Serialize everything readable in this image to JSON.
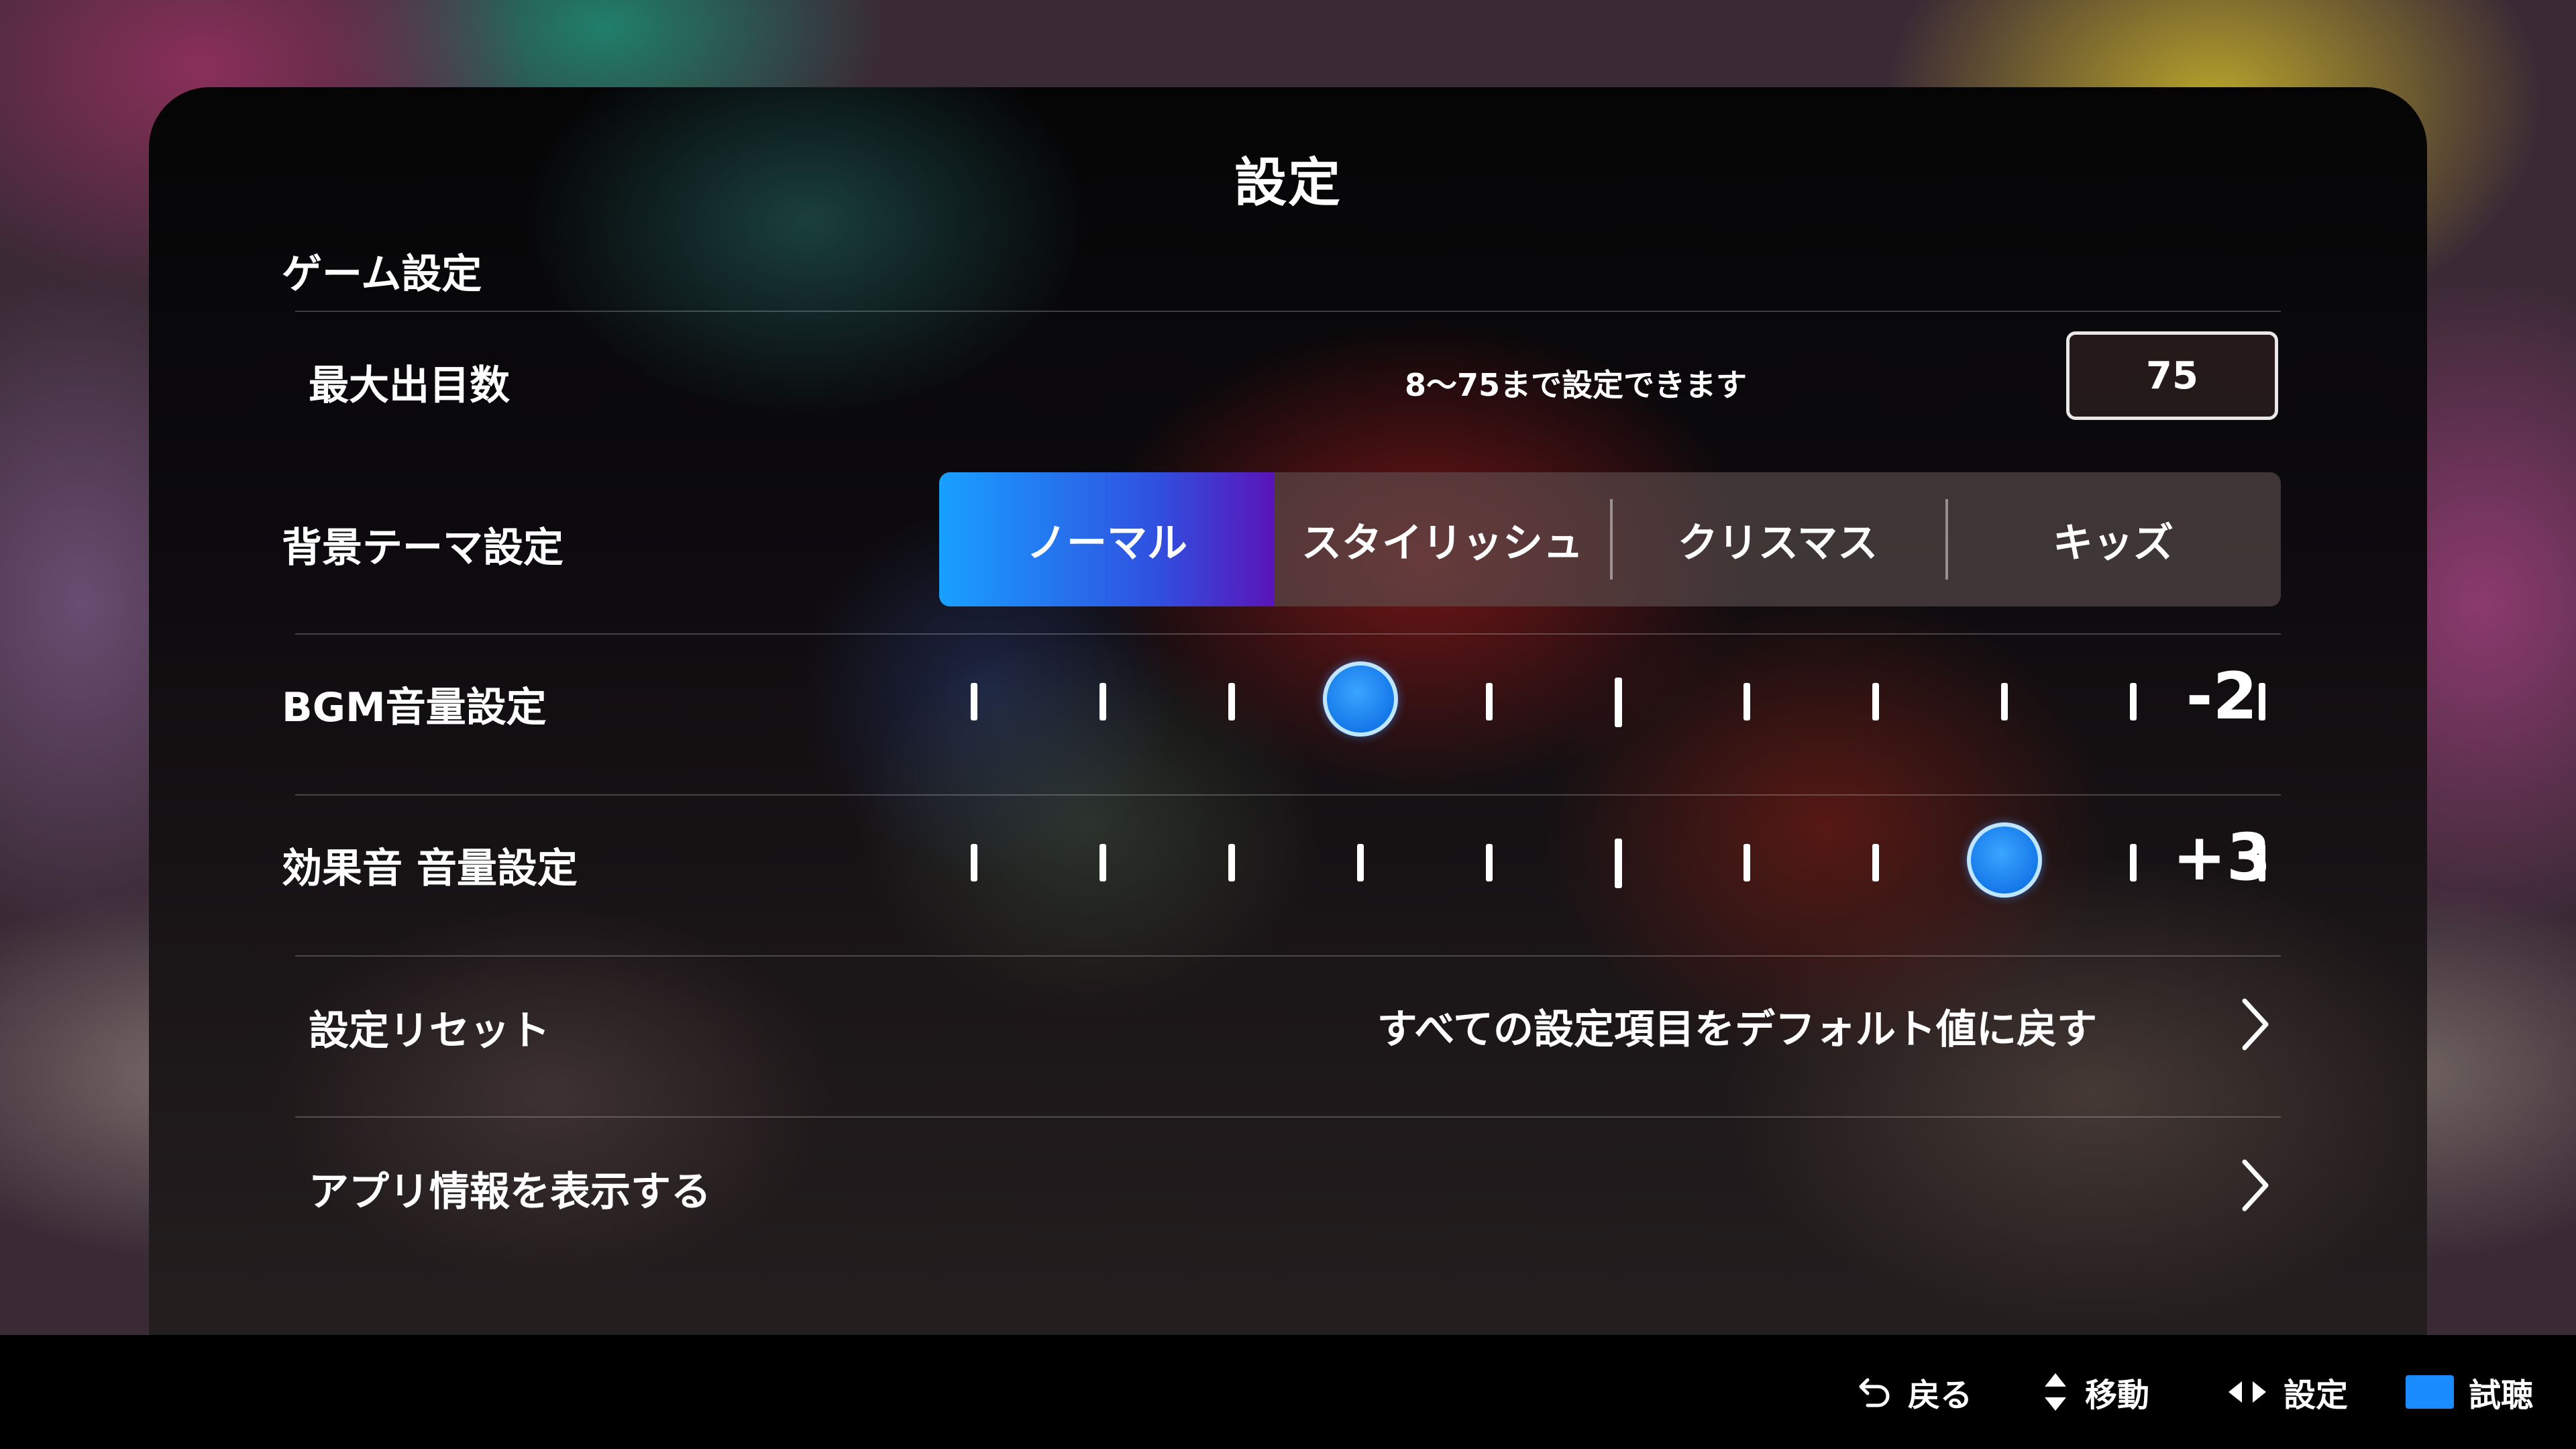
{
  "title": "設定",
  "section_heading": "ゲーム設定",
  "max_draws": {
    "label": "最大出目数",
    "hint": "8〜75まで設定できます",
    "value": "75"
  },
  "theme": {
    "label": "背景テーマ設定",
    "options": [
      "ノーマル",
      "スタイリッシュ",
      "クリスマス",
      "キッズ"
    ],
    "selected": "ノーマル",
    "active_color": "#1aa0ff"
  },
  "bgm_volume": {
    "label": "BGM音量設定",
    "value": "-2",
    "level": -2,
    "min": -5,
    "max": 5
  },
  "se_volume": {
    "label": "効果音 音量設定",
    "value": "+3",
    "level": 3,
    "min": -5,
    "max": 5
  },
  "reset": {
    "label": "設定リセット",
    "description": "すべての設定項目をデフォルト値に戻す",
    "icon": "chevron-right-icon"
  },
  "app_info": {
    "label": "アプリ情報を表示する",
    "icon": "chevron-right-icon"
  },
  "footer": {
    "back": {
      "label": "戻る",
      "icon": "undo-arrow-icon"
    },
    "move": {
      "label": "移動",
      "icon": "up-down-arrows-icon"
    },
    "set": {
      "label": "設定",
      "icon": "left-right-arrows-icon"
    },
    "preview": {
      "label": "試聴",
      "icon": "blue-square-icon",
      "color": "#1a8cff"
    }
  }
}
